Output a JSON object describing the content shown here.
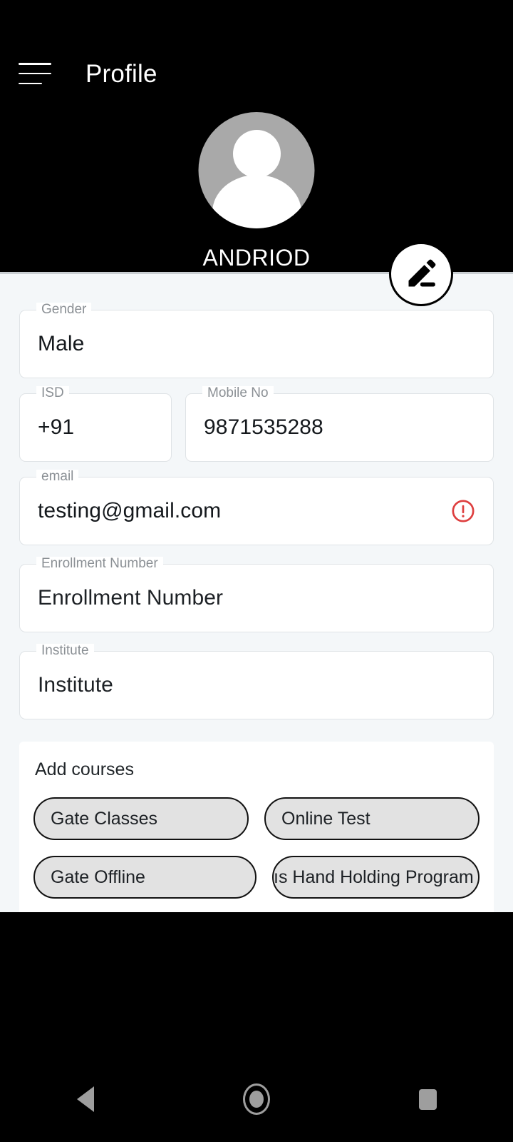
{
  "app": {
    "title": "Profile",
    "menu_icon": "hamburger-menu-icon"
  },
  "profile": {
    "name": "ANDRIOD",
    "avatar_icon": "person-placeholder-icon",
    "edit_icon": "pencil-edit-icon"
  },
  "form": {
    "gender": {
      "label": "Gender",
      "value": "Male"
    },
    "isd": {
      "label": "ISD",
      "value": "+91"
    },
    "mobile": {
      "label": "Mobile No",
      "value": "9871535288"
    },
    "email": {
      "label": "email",
      "value": "testing@gmail.com",
      "error_icon": "error-circle-icon",
      "error_color": "#de3f3f"
    },
    "enrollment": {
      "label": "Enrollment Number",
      "value": "Enrollment Number"
    },
    "institute": {
      "label": "Institute",
      "value": "Institute"
    }
  },
  "courses": {
    "title": "Add courses",
    "chips": [
      {
        "label": "Gate Classes"
      },
      {
        "label": "Online Test"
      },
      {
        "label": "Gate Offline"
      },
      {
        "label": "ıs Hand Holding Program"
      }
    ]
  },
  "navbar": {
    "back": "back-triangle-icon",
    "home": "home-circle-icon",
    "recents": "recents-square-icon"
  },
  "colors": {
    "header_bg": "#000000",
    "content_bg": "#f4f7f9",
    "card_bg": "#ffffff",
    "chip_bg": "#e2e2e2",
    "chip_border": "#121212",
    "label": "#8b9095",
    "error": "#de3f3f"
  }
}
